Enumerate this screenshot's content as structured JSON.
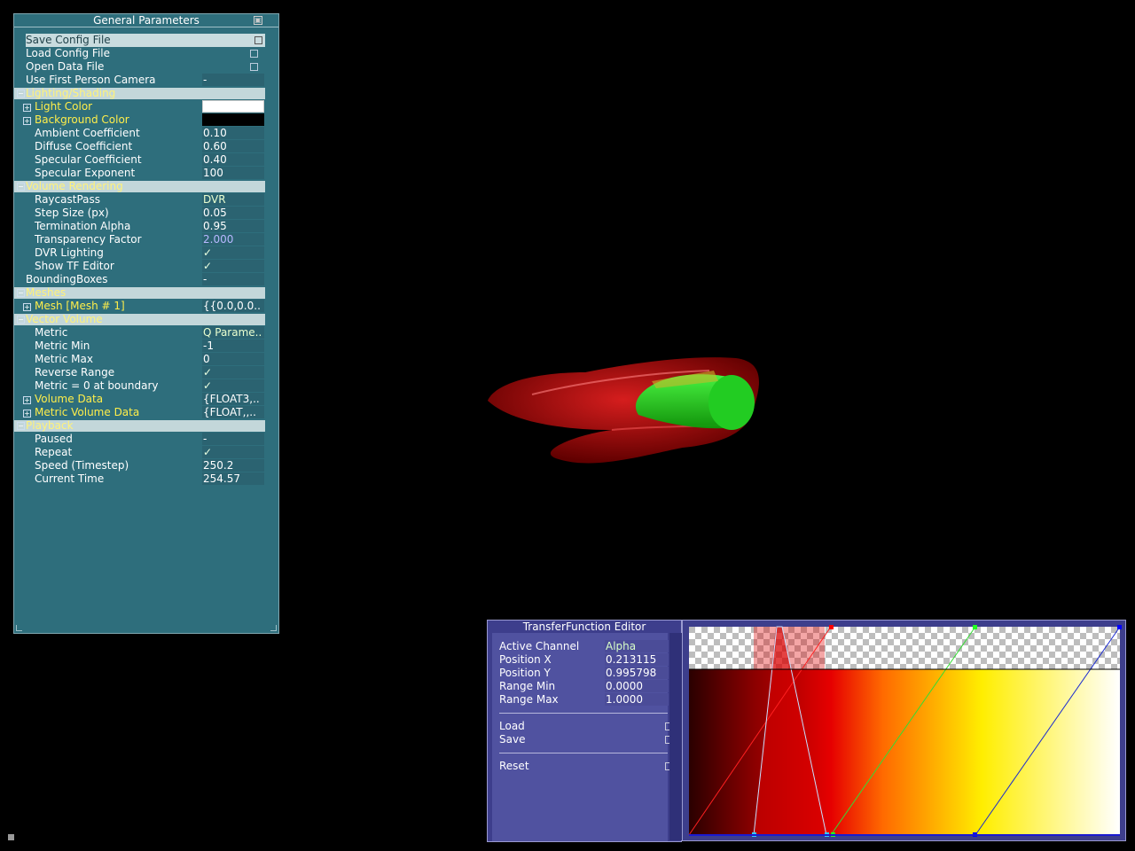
{
  "general_params": {
    "title": "General Parameters",
    "rows": [
      {
        "label": "Save Config File",
        "type": "button"
      },
      {
        "label": "Load Config File",
        "type": "button"
      },
      {
        "label": "Open Data File",
        "type": "button"
      },
      {
        "label": "Use First Person Camera",
        "value": "-"
      }
    ],
    "lighting": {
      "section": "Lighting/Shading",
      "light_color": "Light Color",
      "background_color": "Background Color",
      "light_color_value": "#ffffff",
      "background_color_value": "#000000",
      "ambient": {
        "label": "Ambient Coefficient",
        "value": "0.10"
      },
      "diffuse": {
        "label": "Diffuse Coefficient",
        "value": "0.60"
      },
      "specular": {
        "label": "Specular Coefficient",
        "value": "0.40"
      },
      "exponent": {
        "label": "Specular Exponent",
        "value": "100"
      }
    },
    "volume_rendering": {
      "section": "Volume Rendering",
      "raycast": {
        "label": "RaycastPass",
        "value": "DVR"
      },
      "step": {
        "label": "Step Size (px)",
        "value": "0.05"
      },
      "term": {
        "label": "Termination Alpha",
        "value": "0.95"
      },
      "transp": {
        "label": "Transparency Factor",
        "value": "2.000"
      },
      "dvr_lighting": {
        "label": "DVR Lighting",
        "value": "✓"
      },
      "show_tf": {
        "label": "Show TF Editor",
        "value": "✓"
      }
    },
    "bounding": {
      "label": "BoundingBoxes",
      "value": "-"
    },
    "meshes": {
      "section": "Meshes",
      "mesh": {
        "label": "Mesh [Mesh # 1]",
        "value": "{{0.0,0.0.."
      }
    },
    "vector_volume": {
      "section": "Vector Volume",
      "metric": {
        "label": "Metric",
        "value": "Q Parame.."
      },
      "metric_min": {
        "label": "Metric Min",
        "value": "-1"
      },
      "metric_max": {
        "label": "Metric Max",
        "value": "0"
      },
      "reverse": {
        "label": "Reverse Range",
        "value": "✓"
      },
      "boundary": {
        "label": "Metric = 0 at boundary",
        "value": "✓"
      },
      "volume_data": {
        "label": "Volume Data",
        "value": "{FLOAT3,.."
      },
      "metric_volume_data": {
        "label": "Metric Volume Data",
        "value": "{FLOAT,,.."
      }
    },
    "playback": {
      "section": "Playback",
      "paused": {
        "label": "Paused",
        "value": "-"
      },
      "repeat": {
        "label": "Repeat",
        "value": "✓"
      },
      "speed": {
        "label": "Speed (Timestep)",
        "value": "250.2"
      },
      "current": {
        "label": "Current Time",
        "value": "254.57"
      }
    }
  },
  "tf_editor": {
    "title": "TransferFunction Editor",
    "active_channel": {
      "label": "Active Channel",
      "value": "Alpha"
    },
    "pos_x": {
      "label": "Position X",
      "value": "0.213115"
    },
    "pos_y": {
      "label": "Position Y",
      "value": "0.995798"
    },
    "range_min": {
      "label": "Range Min",
      "value": "0.0000"
    },
    "range_max": {
      "label": "Range Max",
      "value": "1.0000"
    },
    "load": "Load",
    "save": "Save",
    "reset": "Reset"
  },
  "colors": {
    "panel": "#2e6e7c",
    "section_text": "#fff27a",
    "tf_panel": "#5052a0",
    "vortex": "#c20000",
    "cylinder": "#22dd22"
  },
  "viewport": {
    "icons": [
      "vortex-volume",
      "green-cylinder"
    ]
  }
}
